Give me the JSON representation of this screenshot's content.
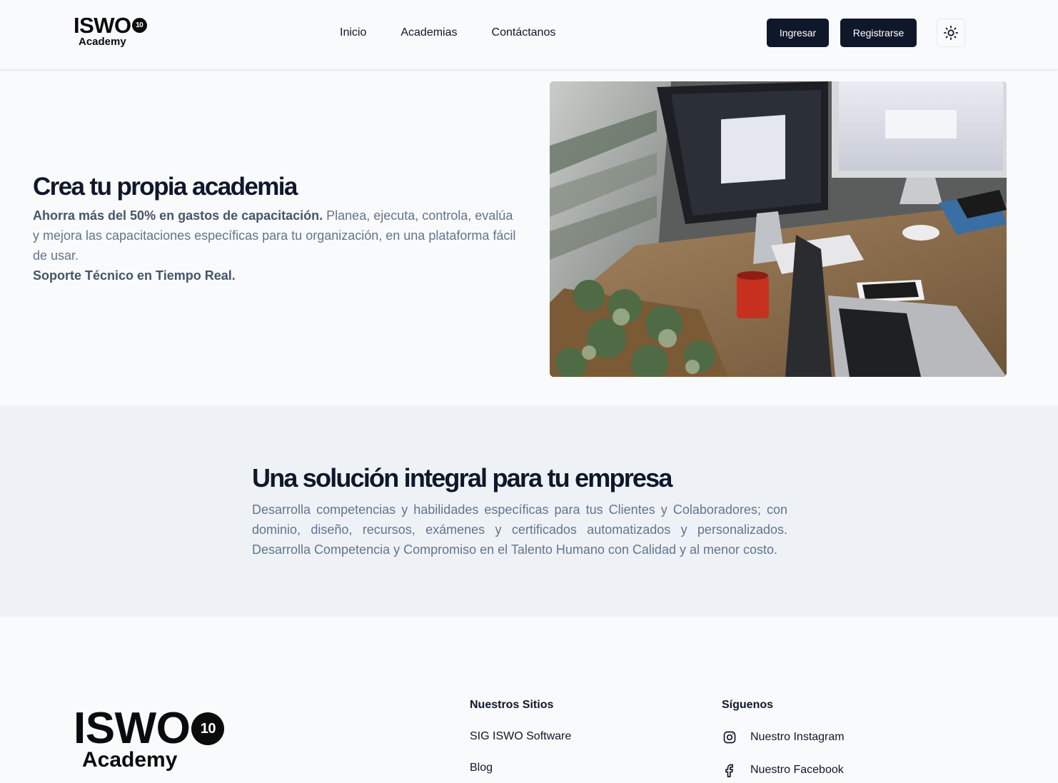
{
  "header": {
    "logo": {
      "main": "ISWO",
      "badge": "10",
      "sub": "Academy"
    },
    "nav": [
      {
        "label": "Inicio"
      },
      {
        "label": "Academias"
      },
      {
        "label": "Contáctanos"
      }
    ],
    "login_label": "Ingresar",
    "register_label": "Registrarse",
    "theme_icon": "sun-icon"
  },
  "hero": {
    "title": "Crea tu propia academia",
    "desc_bold": "Ahorra más del 50% en gastos de capacitación.",
    "desc_text": " Planea, ejecuta, controla, evalúa y mejora las capacitaciones específicas para tu organización, en una plataforma fácil de usar.",
    "support": "Soporte Técnico en Tiempo Real."
  },
  "solution": {
    "title": "Una solución integral para tu empresa",
    "description": "Desarrolla competencias y habilidades específicas para tus Clientes y Colaboradores; con dominio, diseño, recursos, exámenes y certificados automatizados y personalizados. Desarrolla Competencia y Compromiso en el Talento Humano con Calidad y al menor costo."
  },
  "footer": {
    "logo": {
      "main": "ISWO",
      "badge": "10",
      "sub": "Academy"
    },
    "sites": {
      "heading": "Nuestros Sitios",
      "links": [
        {
          "label": "SIG ISWO Software"
        },
        {
          "label": "Blog"
        }
      ]
    },
    "social": {
      "heading": "Síguenos",
      "links": [
        {
          "label": "Nuestro Instagram",
          "icon": "instagram-icon"
        },
        {
          "label": "Nuestro Facebook",
          "icon": "facebook-icon"
        }
      ]
    }
  },
  "colors": {
    "background": "#f8fafc",
    "section_alt": "#eef2f7",
    "primary_button": "#0f172a",
    "heading": "#0f172a",
    "muted_text": "#64748b"
  }
}
